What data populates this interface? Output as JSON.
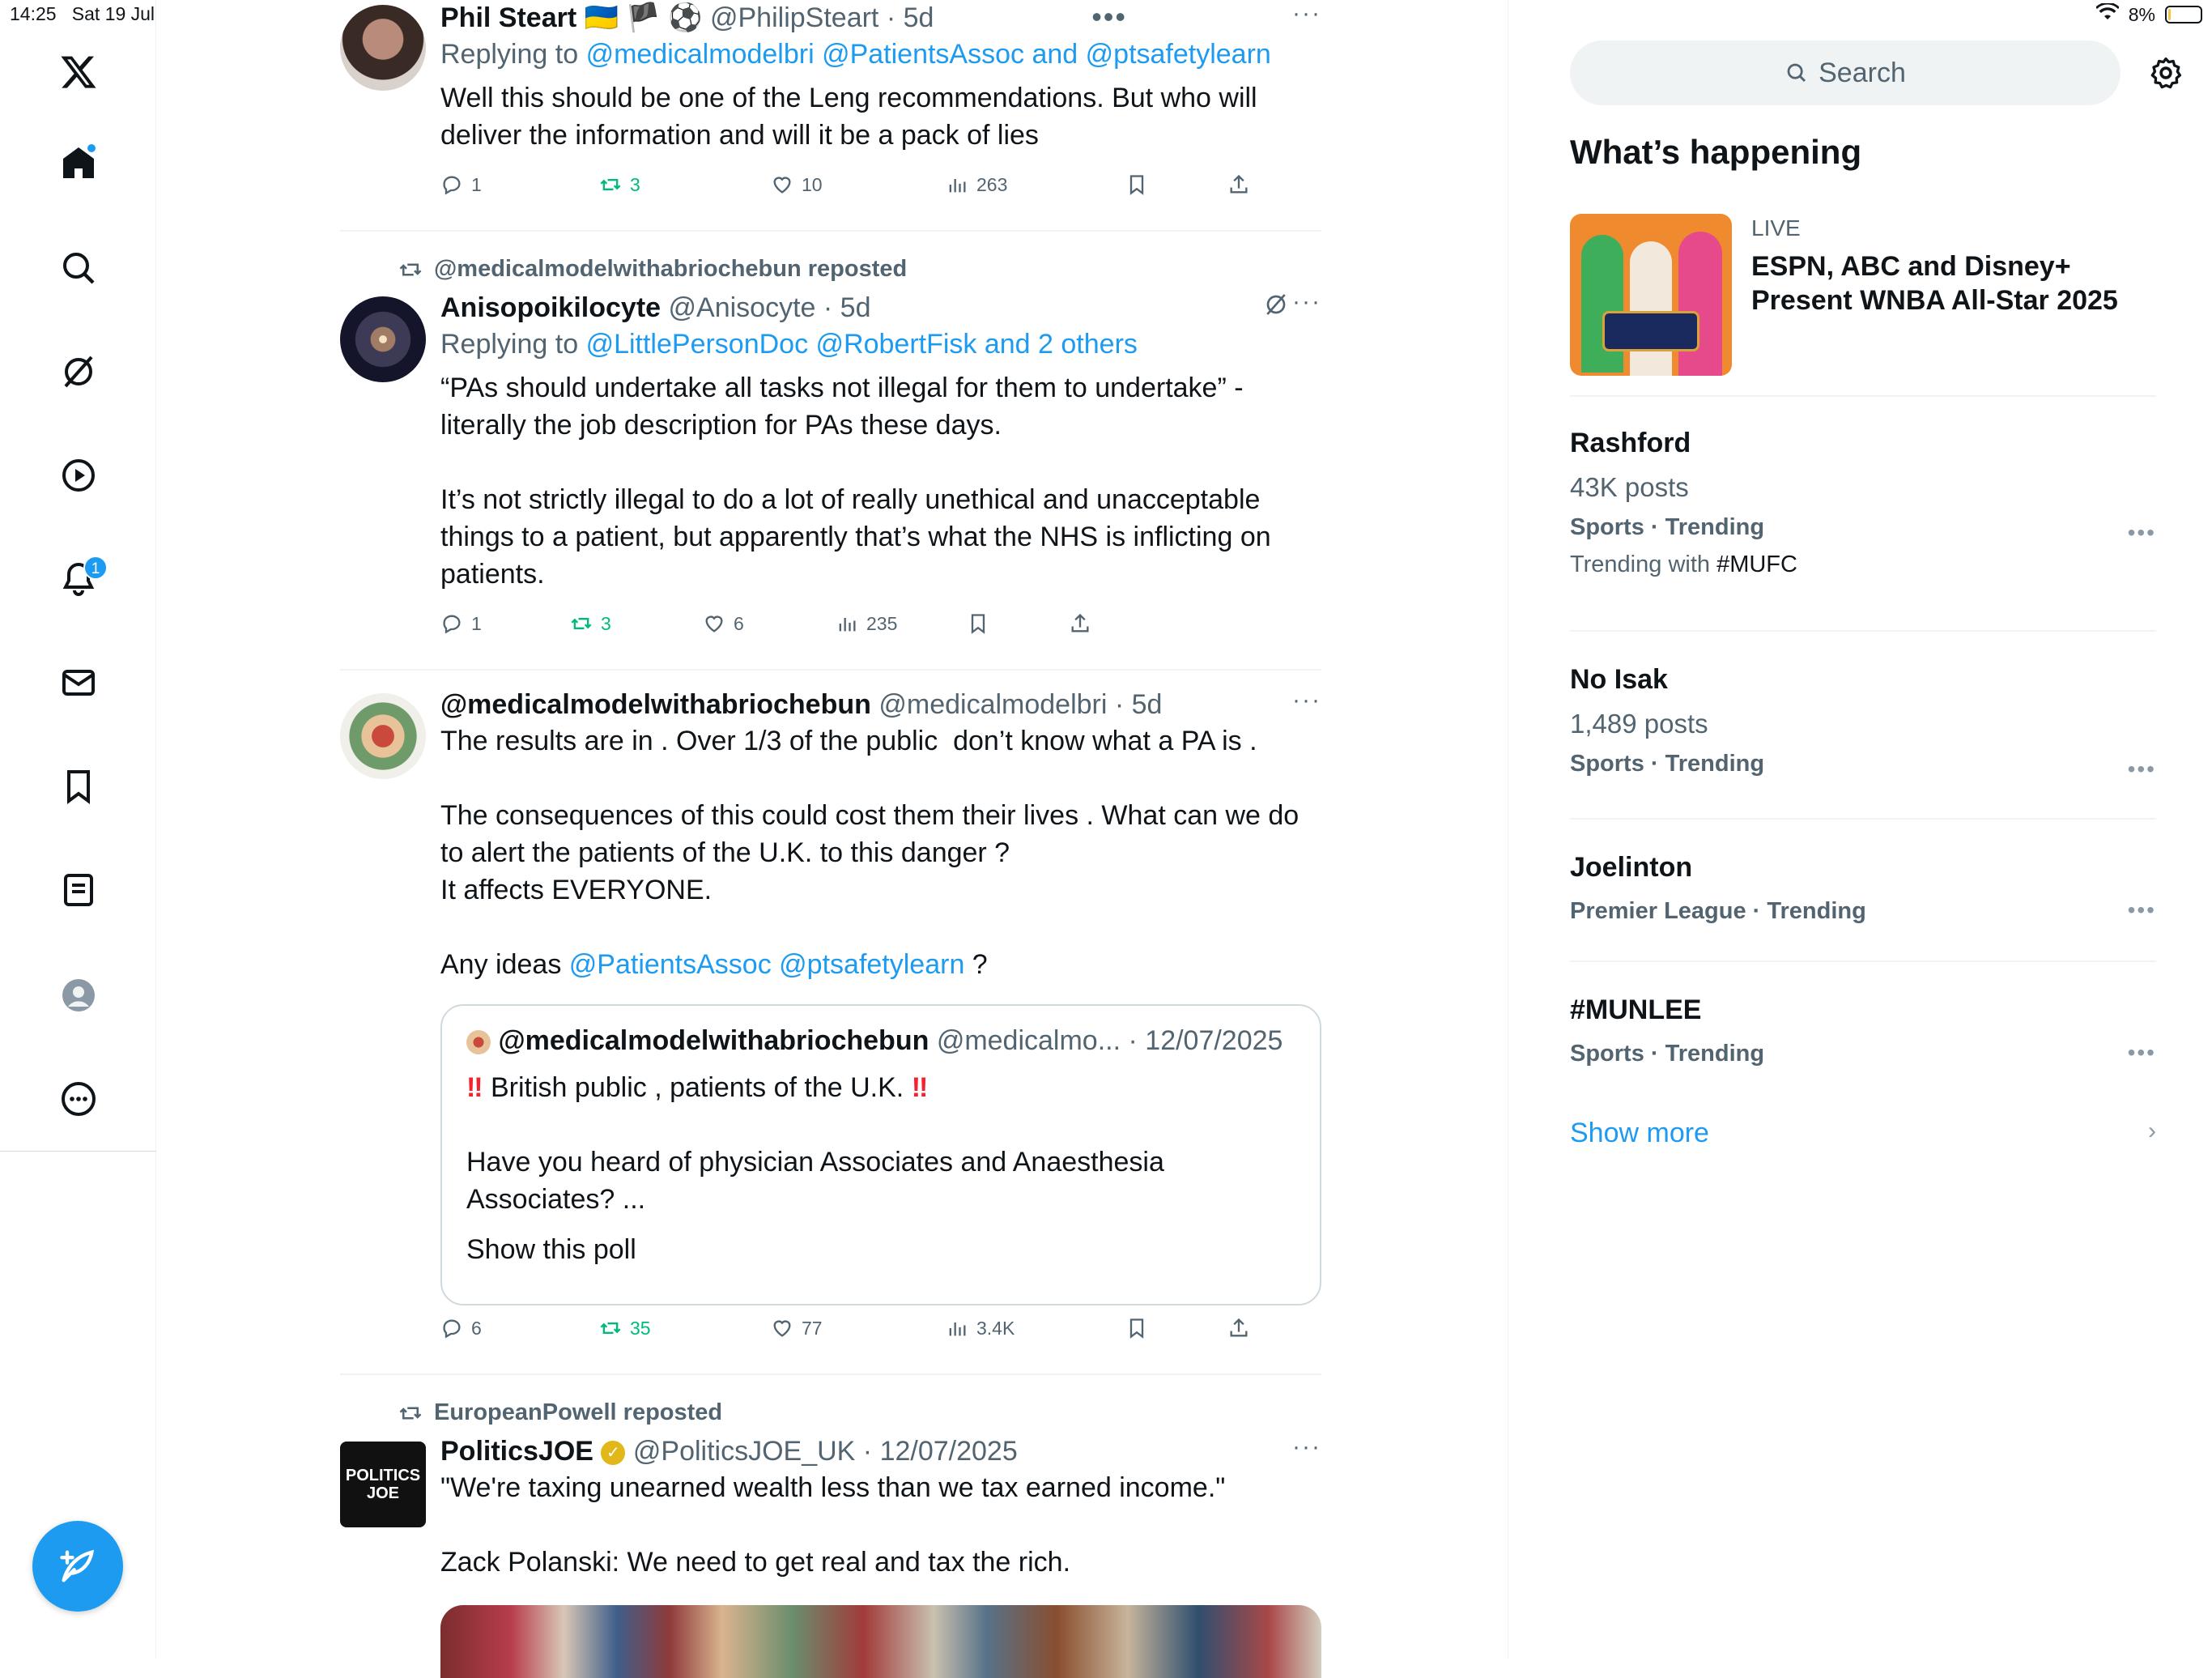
{
  "status": {
    "time": "14:25",
    "date": "Sat 19 Jul",
    "battery": "8%"
  },
  "nav": {
    "notif_count": "1"
  },
  "posts": [
    {
      "name": "Phil Steart",
      "flags": "🇺🇦 🏴 ⚽️",
      "handle": "@PhilipSteart",
      "time": "5d",
      "reply_prefix": "Replying to",
      "reply_to": "@medicalmodelbri @PatientsAssoc and @ptsafetylearn",
      "text": "Well this should be one of the Leng recommendations. But who will deliver the information and will it be a pack of lies",
      "replies": "1",
      "reposts": "3",
      "likes": "10",
      "views": "263"
    },
    {
      "repost_by": "@medicalmodelwithabriochebun reposted",
      "name": "Anisopoikilocyte",
      "handle": "@Anisocyte",
      "time": "5d",
      "reply_prefix": "Replying to",
      "reply_to": "@LittlePersonDoc @RobertFisk and 2 others",
      "text": "“PAs should undertake all tasks not illegal for them to undertake” - literally the job description for PAs these days.\n\nIt’s not strictly illegal to do a lot of really unethical and unacceptable things to a patient, but apparently that’s what the NHS is inflicting on patients.",
      "replies": "1",
      "reposts": "3",
      "likes": "6",
      "views": "235"
    },
    {
      "name": "@medicalmodelwithabriochebun",
      "handle": "@medicalmodelbri",
      "time": "5d",
      "text": "The results are in . Over 1/3 of the public  don’t know what a PA is .\n\nThe consequences of this could cost them their lives . What can we do to alert the patients of the U.K. to this danger ?\nIt affects EVERYONE.\n\nAny ideas ",
      "text_links": "@PatientsAssoc @ptsafetylearn",
      "text_end": " ?",
      "quote": {
        "name": "@medicalmodelwithabriochebun",
        "handle": "@medicalmo...",
        "date": "12/07/2025",
        "line1": "British public , patients of the U.K.",
        "line2": "Have you heard of physician Associates and Anaesthesia Associates? ...",
        "poll_link": "Show this poll"
      },
      "replies": "6",
      "reposts": "35",
      "likes": "77",
      "views": "3.4K"
    },
    {
      "repost_by": "EuropeanPowell reposted",
      "name": "PoliticsJOE",
      "handle": "@PoliticsJOE_UK",
      "time": "12/07/2025",
      "avatar_text": "POLITICS JOE",
      "text": "\"We're taxing unearned wealth less than we tax earned income.\"\n\nZack Polanski: We need to get real and tax the rich."
    }
  ],
  "sidebar": {
    "search_placeholder": "Search",
    "heading": "What’s happening",
    "live": {
      "tag": "LIVE",
      "title": "ESPN, ABC and Disney+ Present WNBA All-Star 2025"
    },
    "trends": [
      {
        "title": "Rashford",
        "posts": "43K posts",
        "category": "Sports · Trending",
        "with_prefix": "Trending with ",
        "with_tag": "#MUFC"
      },
      {
        "title": "No Isak",
        "posts": "1,489 posts",
        "category": "Sports · Trending"
      },
      {
        "title": "Joelinton",
        "category": "Premier League · Trending"
      },
      {
        "title": "#MUNLEE",
        "category": "Sports · Trending"
      }
    ],
    "show_more": "Show more"
  },
  "colors": {
    "accent": "#1d9bf0",
    "repost_green": "#00ba7c",
    "muted": "#536471"
  }
}
